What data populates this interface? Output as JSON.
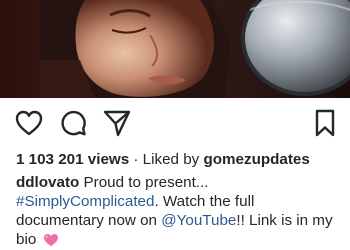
{
  "post": {
    "views_count": "1 103 201 views",
    "liked_by_prefix": "· Liked by",
    "liked_by_user": "gomezupdates",
    "caption": {
      "username": "ddlovato",
      "text_1": "Proud to present...",
      "hashtag": "#SimplyComplicated",
      "text_2": ". Watch the full documentary now on",
      "mention": "@YouTube",
      "text_3": "!! Link is in my bio",
      "emoji": "pink-heart-emoji"
    }
  },
  "actions": {
    "like_icon": "heart-outline-icon",
    "comment_icon": "comment-bubble-icon",
    "share_icon": "paper-plane-icon",
    "save_icon": "bookmark-icon"
  },
  "colors": {
    "text": "#262626",
    "link": "#2c5b8f",
    "emoji_pink": "#f06ca8"
  }
}
